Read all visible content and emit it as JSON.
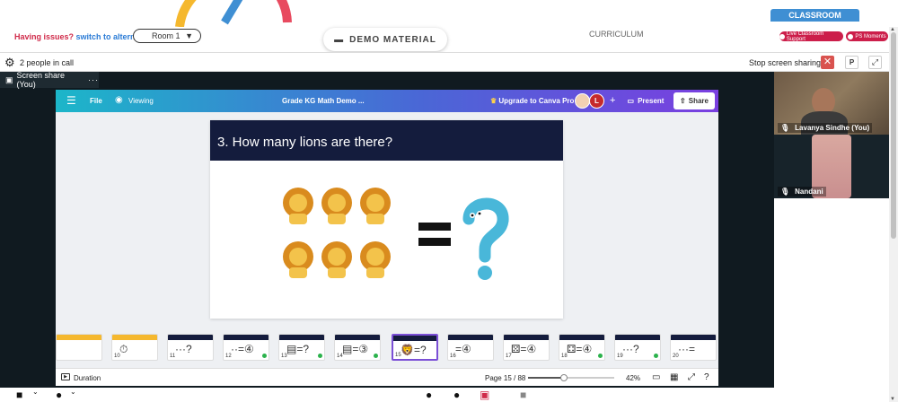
{
  "topbar": {
    "issues_text": "Having issues?",
    "switch_text": "switch to alternate room",
    "room_value": "Room 1",
    "demo_material": "DEMO MATERIAL",
    "curriculum": "CURRICULUM",
    "classroom_tab": "CLASSROOM",
    "live_support": "Live Classroom Support",
    "ps_moments": "PS Moments"
  },
  "callbar": {
    "people": "2 people in call",
    "stop_share": "Stop screen sharing",
    "pin_label": "P"
  },
  "share": {
    "tab_label": "Screen share (You)",
    "canva": {
      "file": "File",
      "viewing": "Viewing",
      "doc_title": "Grade KG Math Demo ...",
      "upgrade": "Upgrade to Canva Pro",
      "avatar_initial": "L",
      "present": "Present",
      "share": "Share"
    },
    "slide": {
      "title": "3. How many lions are there?"
    },
    "thumbnails": [
      {
        "num": "",
        "body": "",
        "check": false
      },
      {
        "num": "10",
        "body": "⏱",
        "check": false
      },
      {
        "num": "11",
        "body": "···?",
        "check": false
      },
      {
        "num": "12",
        "body": "··=④",
        "check": true
      },
      {
        "num": "13",
        "body": "▤=?",
        "check": true
      },
      {
        "num": "14",
        "body": "▤=③",
        "check": true
      },
      {
        "num": "15",
        "body": "🦁=?",
        "check": false
      },
      {
        "num": "16",
        "body": "=④",
        "check": false
      },
      {
        "num": "17",
        "body": "⚄=④",
        "check": false
      },
      {
        "num": "18",
        "body": "⚃=④",
        "check": true
      },
      {
        "num": "19",
        "body": "···?",
        "check": true
      },
      {
        "num": "20",
        "body": "···=",
        "check": false
      }
    ],
    "footer": {
      "duration": "Duration",
      "page": "Page 15 / 88",
      "zoom": "42%",
      "zoom_fraction": 0.42
    }
  },
  "participants": [
    {
      "name": "Lavanya Sindhe (You)"
    },
    {
      "name": "Nandani"
    }
  ],
  "colors": {
    "slide_header": "#141c3d",
    "accent_red": "#cc1e4a",
    "classroom_blue": "#3f8fd3",
    "canva_purple": "#7b4fd6"
  }
}
